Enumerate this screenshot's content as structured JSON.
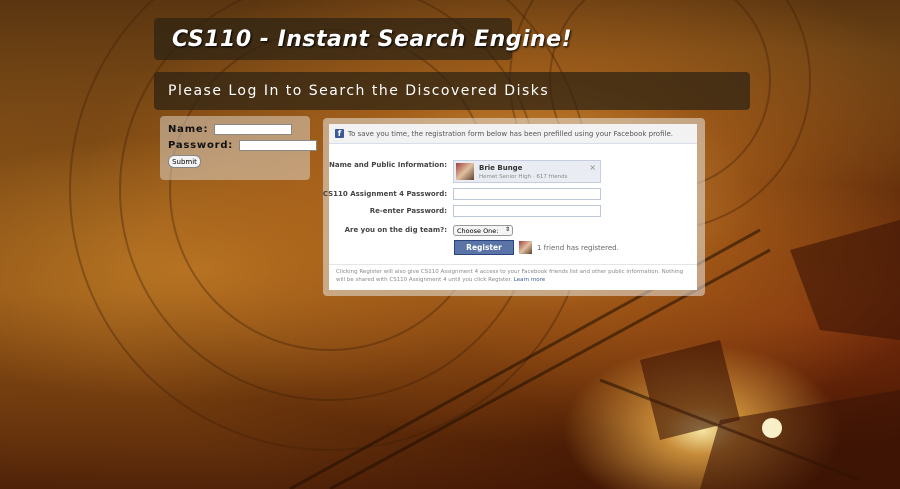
{
  "header": {
    "title": "CS110 - Instant Search Engine!",
    "subtitle": "Please Log In to Search the Discovered Disks"
  },
  "login": {
    "name_label": "Name:",
    "name_value": "",
    "password_label": "Password:",
    "password_value": "",
    "submit_label": "Submit"
  },
  "facebook": {
    "logo_glyph": "f",
    "header_text": "To save you time, the registration form below has been prefilled using your Facebook profile.",
    "name_info_label": "Name and Public Information:",
    "profile_name": "Brie Bunge",
    "profile_detail": "Hemet Senior High · 617 friends",
    "close_glyph": "×",
    "password_label": "CS110 Assignment 4 Password:",
    "reenter_label": "Re-enter Password:",
    "dig_team_label": "Are you on the dig team?:",
    "dig_team_selected": "Choose One:",
    "select_arrow_glyph": "⇕",
    "register_label": "Register",
    "friends_registered": "1 friend has registered.",
    "fine_print": "Clicking Register will also give CS110 Assignment 4 access to your Facebook friends list and other public information. Nothing will be shared with CS110 Assignment 4 until you click Register.",
    "learn_more": "Learn more",
    "colors": {
      "fb_blue": "#3b5998",
      "register_button": "#5b74a8"
    }
  }
}
